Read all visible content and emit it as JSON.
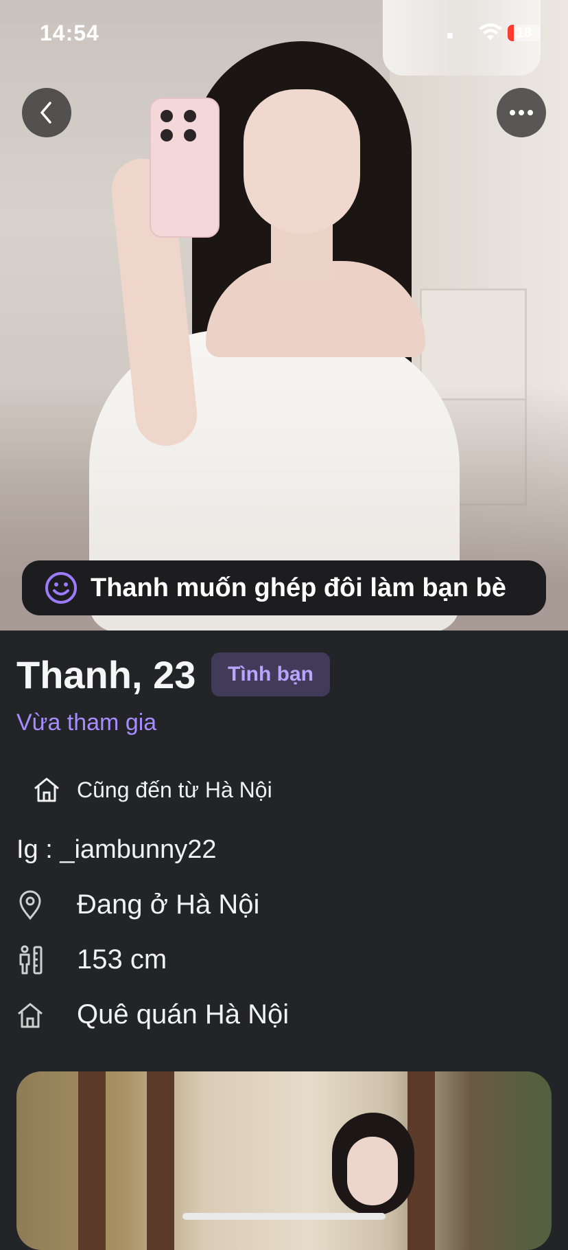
{
  "status_bar": {
    "time": "14:54",
    "battery": "18"
  },
  "nav": {
    "back_icon": "chevron-left-icon",
    "more_icon": "ellipsis-icon"
  },
  "hero": {
    "photo_subject": "profile-photo",
    "match_text": "Thanh muốn ghép đôi làm bạn bè",
    "match_icon": "smiley-icon"
  },
  "profile": {
    "name_age": "Thanh, 23",
    "intent_badge": "Tình bạn",
    "joined_text": "Vừa tham gia",
    "common_text": "Cũng đến từ Hà Nội",
    "bio": "Ig : _iambunny22",
    "details": [
      {
        "icon": "location-pin-icon",
        "text": "Đang ở Hà Nội"
      },
      {
        "icon": "height-icon",
        "text": "153 cm"
      },
      {
        "icon": "home-icon",
        "text": "Quê quán Hà Nội"
      }
    ]
  },
  "colors": {
    "background": "#232428",
    "accent": "#a68cff",
    "badge_bg": "#413a58"
  }
}
